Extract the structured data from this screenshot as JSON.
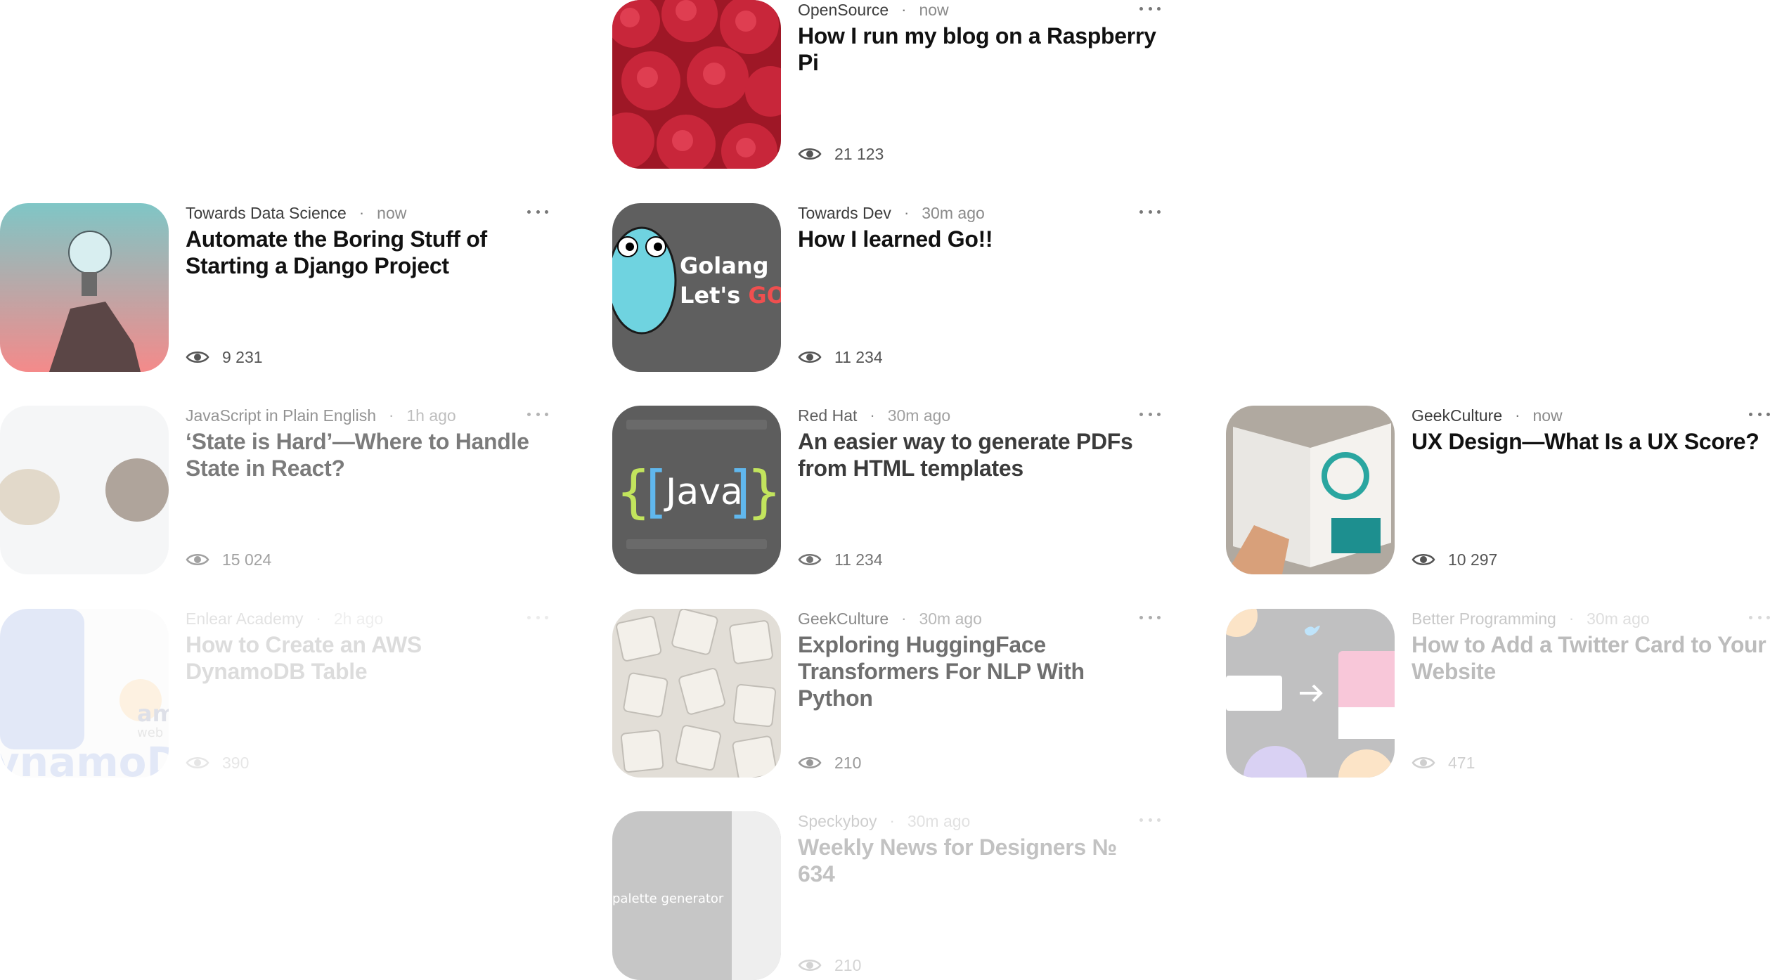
{
  "cards": [
    {
      "publication": "OpenSource",
      "time": "now",
      "title": "How I run my blog on a Raspberry Pi",
      "views": "21 123",
      "image": "raspberry-pi-image"
    },
    {
      "publication": "Towards Data Science",
      "time": "now",
      "title": "Automate the Boring Stuff of Starting a Django Project",
      "views": "9 231",
      "image": "lightbulb-image"
    },
    {
      "publication": "Towards Dev",
      "time": "30m ago",
      "title": "How I learned Go!!",
      "views": "11 234",
      "image": "golang-image",
      "image_text": [
        "Golang",
        "Let's ",
        "GO",
        "!"
      ]
    },
    {
      "publication": "JavaScript in Plain English",
      "time": "1h ago",
      "title": "‘State is Hard’—Where to Handle State in React?",
      "views": "15 024",
      "image": "beans-image"
    },
    {
      "publication": "Red Hat",
      "time": "30m ago",
      "title": "An easier way to generate PDFs from HTML templates",
      "views": "11 234",
      "image": "java-image",
      "image_text": "Java"
    },
    {
      "publication": "GeekCulture",
      "time": "now",
      "title": "UX Design—What Is a UX Score?",
      "views": "10 297",
      "image": "ux-book-image"
    },
    {
      "publication": "Enlear Academy",
      "time": "2h ago",
      "title": "How to Create an AWS DynamoDB Table",
      "views": "390",
      "image": "dynamodb-image",
      "image_text": [
        "am",
        "web",
        "ynamoD"
      ]
    },
    {
      "publication": "GeekCulture",
      "time": "30m ago",
      "title": "Exploring HuggingFace Transformers For NLP With Python",
      "views": "210",
      "image": "letter-tiles-image"
    },
    {
      "publication": "Better Programming",
      "time": "30m ago",
      "title": "How to Add a Twitter Card to Your Website",
      "views": "471",
      "image": "twitter-card-image"
    },
    {
      "publication": "Speckyboy",
      "time": "30m ago",
      "title": "Weekly News for Designers № 634",
      "views": "210",
      "image": "palette-image",
      "image_text": "palette generator"
    }
  ],
  "colors": {
    "title": "#111111",
    "meta": "#3c3c3c",
    "time": "#8a8a8a",
    "icon": "#555555"
  }
}
